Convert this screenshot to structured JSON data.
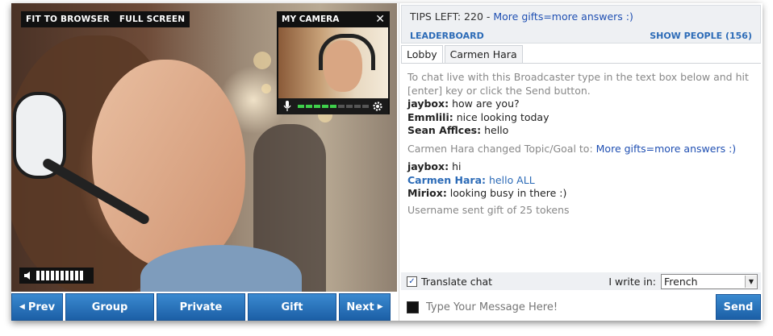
{
  "video": {
    "fit_label": "FIT TO BROWSER",
    "full_label": "FULL SCREEN",
    "my_camera_label": "MY CAMERA",
    "close_glyph": "✕",
    "mic_level": 0.55,
    "volume_level": 1.0
  },
  "controls": {
    "prev": "Prev",
    "group": "Group",
    "private": "Private",
    "gift": "Gift",
    "next": "Next"
  },
  "chat": {
    "tips_prefix": "TIPS LEFT: 220 - ",
    "tips_link": "More gifts=more answers :)",
    "leaderboard": "LEADERBOARD",
    "show_people": "SHOW PEOPLE (156)",
    "tabs": [
      {
        "label": "Lobby",
        "active": true
      },
      {
        "label": "Carmen Hara",
        "active": false
      }
    ],
    "intro": "To chat live with this Broadcaster type in the text box below and hit [enter] key or click the Send button.",
    "m1": {
      "user": "jaybox:",
      "text": " how are you?"
    },
    "m2": {
      "user": "Emmlili:",
      "text": " nice looking today"
    },
    "m3": {
      "user": "Sean Afflces:",
      "text": " hello"
    },
    "topic_prefix": "Carmen Hara changed Topic/Goal to: ",
    "topic_link": "More gifts=more answers :)",
    "m4": {
      "user": "jaybox:",
      "text": " hi"
    },
    "m5": {
      "user": "Carmen Hara:",
      "text": " hello ALL"
    },
    "m6": {
      "user": "Miriox:",
      "text": " looking busy in there :)"
    },
    "gift_notice": "Username sent gift of 25 tokens",
    "translate_label": "Translate chat",
    "translate_checked": "✓",
    "i_write_in": "I write in:",
    "language": "French",
    "message_placeholder": "Type Your Message Here!",
    "send": "Send"
  },
  "colors": {
    "button_blue": "#1c5fa6",
    "link_blue": "#1f4fb2",
    "header_blue": "#2c6bb7",
    "meter_green": "#3fcf4b"
  }
}
